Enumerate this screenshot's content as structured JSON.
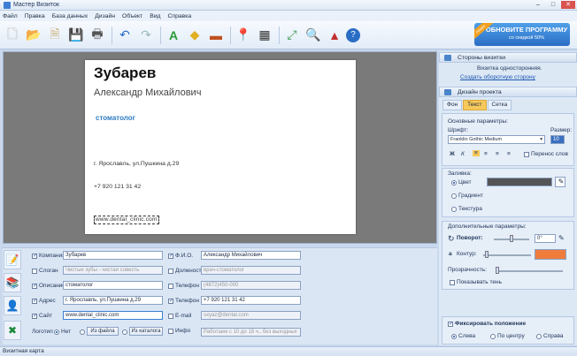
{
  "window": {
    "title": "Мастер Визиток"
  },
  "menu": [
    "Файл",
    "Правка",
    "База данных",
    "Дизайн",
    "Объект",
    "Вид",
    "Справка"
  ],
  "promo": {
    "ribbon": "скидка",
    "line1": "ОБНОВИТЕ ПРОГРАММУ",
    "line2": "со скидкой 50%"
  },
  "card": {
    "name": "Зубарев",
    "fio": "Александр Михайлович",
    "position": "стоматолог",
    "address": "г. Ярославль, ул.Пушкина д.29",
    "phone": "+7 920 121 31 42",
    "site": "www.dental_clinic.com"
  },
  "fields": {
    "company": {
      "label": "Компания",
      "value": "Зубарев"
    },
    "slogan": {
      "label": "Слоган",
      "value": "Чистые зубы - чистая совесть"
    },
    "position": {
      "label": "Описание",
      "value": "стоматолог"
    },
    "address": {
      "label": "Адрес",
      "value": "г. Ярославль, ул.Пушкина д.29"
    },
    "site": {
      "label": "Сайт",
      "value": "www.dental_clinic.com"
    },
    "logo": {
      "label": "Логотип",
      "opt_none": "Нет",
      "opt_file": "Из файла",
      "opt_catalog": "Из каталога"
    },
    "fio": {
      "label": "Ф.И.О.",
      "value": "Александр Михайлович"
    },
    "role": {
      "label": "Должность",
      "value": "врач-стоматолог"
    },
    "phone1": {
      "label": "Телефон 1",
      "value": "(4872)450-000"
    },
    "phone2": {
      "label": "Телефон 2",
      "value": "+7 920 121 31 42"
    },
    "email": {
      "label": "E-mail",
      "value": "sxyaz@dental.com"
    },
    "info": {
      "label": "Инфо",
      "value": "Работаем с 10 до 18 ч., без выходных"
    }
  },
  "panel": {
    "sides": {
      "title": "Стороны визитки",
      "note": "Визитка односторонняя.",
      "link": "Создать оборотную сторону"
    },
    "design": {
      "title": "Дизайн проекта",
      "tabs": [
        "Фон",
        "Текст",
        "Сетка"
      ]
    },
    "basic": {
      "title": "Основные параметры:",
      "font_label": "Шрифт:",
      "font": "Franklin Gothic Medium",
      "size_label": "Размер:",
      "size": "10",
      "wrap": "Перенос слов"
    },
    "fill": {
      "title": "Заливка:",
      "color": "Цвет",
      "gradient": "Градиент",
      "texture": "Текстура"
    },
    "extra": {
      "title": "Дополнительные параметры:",
      "rotate": "Поворот:",
      "rotate_val": "0°",
      "outline": "Контур:",
      "transparency": "Прозрачность:",
      "shadow": "Показывать тень"
    },
    "fix": {
      "title": "Фиксировать положение",
      "left": "Слева",
      "center": "По центру",
      "right": "Справа"
    }
  },
  "status": "Визитная карта",
  "colors": {
    "accent": "#2d7cc1",
    "outline": "#f07c3c",
    "fill": "#555555"
  }
}
